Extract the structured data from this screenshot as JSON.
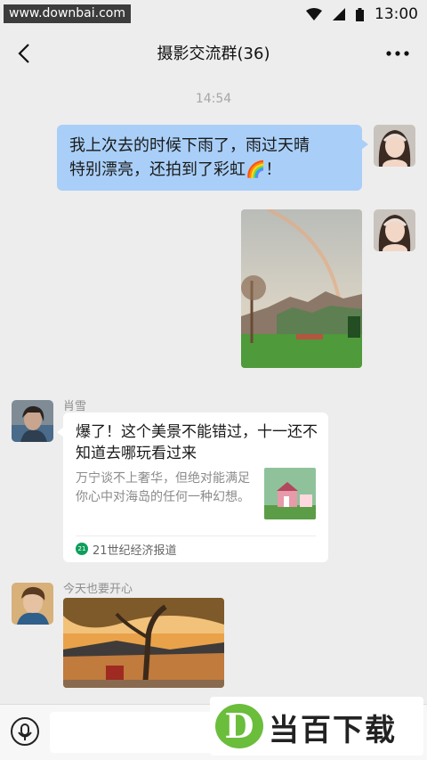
{
  "status_bar": {
    "watermark": "www.downbai.com",
    "clock": "13:00",
    "icons": [
      "wifi-icon",
      "cellular-signal-icon",
      "battery-icon"
    ]
  },
  "header": {
    "title": "摄影交流群(36)",
    "icons": [
      "back-arrow-icon",
      "more-dots-icon"
    ]
  },
  "chat": {
    "timestamp": "14:54",
    "message_1": {
      "line_1": "我上次去的时候下雨了，雨过天晴",
      "line_2": "特别漂亮，还拍到了彩虹🌈！",
      "bubble_color": "#a9cff8"
    },
    "message_2": {
      "type": "image",
      "subject": "rainbow over mountain meadow"
    },
    "message_3": {
      "sender": "肖雪",
      "card": {
        "title": "爆了！这个美景不能错过，十一还不知道去哪玩看过来",
        "description": "万宁谈不上奢华，但绝对能满足你心中对海岛的任何一种幻想。",
        "source": "21世纪经济报道",
        "source_badge": "21"
      }
    },
    "message_4": {
      "sender": "今天也要开心",
      "type": "image",
      "subject": "tree in front of traditional courtyard"
    }
  },
  "input_bar": {
    "icons": [
      "voice-mic-icon"
    ]
  },
  "watermark_logo": {
    "letter": "D",
    "text": "当百下载",
    "color": "#6bbd3c"
  }
}
